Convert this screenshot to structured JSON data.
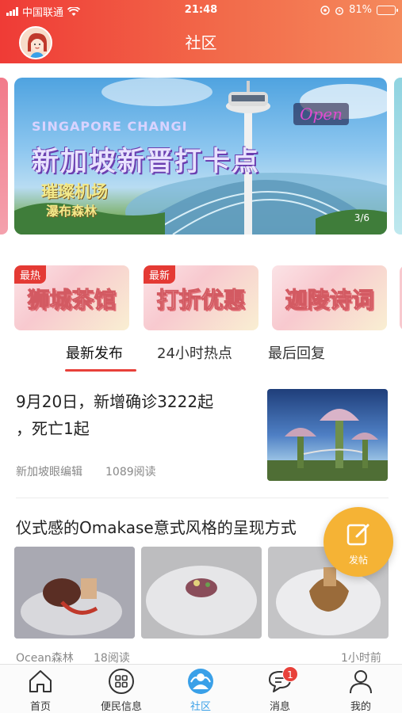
{
  "status_bar": {
    "carrier": "中国联通",
    "time": "21:48",
    "battery": "81%",
    "battery_level": 0.81
  },
  "header": {
    "title": "社区"
  },
  "banner": {
    "kicker": "SINGAPORE CHANGI",
    "headline": "新加坡新晋打卡点",
    "sub1": "璀璨机场",
    "sub2": "瀑布森林",
    "tag": "Open",
    "pager": "3/6"
  },
  "categories": [
    {
      "badge": "最热",
      "label": "狮城茶馆"
    },
    {
      "badge": "最新",
      "label": "打折优惠"
    },
    {
      "badge": "",
      "label": "迦陵诗词"
    }
  ],
  "tabs": [
    {
      "label": "最新发布",
      "active": true
    },
    {
      "label": "24小时热点",
      "active": false
    },
    {
      "label": "最后回复",
      "active": false
    }
  ],
  "posts": [
    {
      "title_line1": "9月20日，新增确诊3222起",
      "title_line2": "，死亡1起",
      "author": "新加坡眼编辑",
      "reads": "1089阅读"
    },
    {
      "title": "仪式感的Omakase意式风格的呈现方式",
      "author": "Ocean森林",
      "reads": "18阅读",
      "time": "1小时前"
    }
  ],
  "fab": {
    "label": "发帖"
  },
  "tabbar": [
    {
      "label": "首页",
      "icon": "home-icon",
      "active": false
    },
    {
      "label": "便民信息",
      "icon": "grid-icon",
      "active": false
    },
    {
      "label": "社区",
      "icon": "community-icon",
      "active": true
    },
    {
      "label": "消息",
      "icon": "message-icon",
      "active": false,
      "badge": "1"
    },
    {
      "label": "我的",
      "icon": "user-icon",
      "active": false
    }
  ],
  "colors": {
    "brand_red": "#ef3b36",
    "active_tab_blue": "#3aa0e8",
    "fab_orange": "#f5b335"
  }
}
